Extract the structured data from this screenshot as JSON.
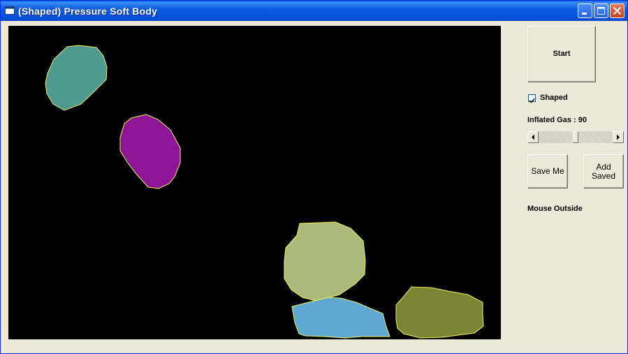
{
  "window": {
    "title": "(Shaped) Pressure Soft Body",
    "titlebar_color": "#0551DC",
    "icons": [
      "app-window-icon",
      "minimize-icon",
      "maximize-icon",
      "close-icon"
    ]
  },
  "controls": {
    "start_label": "Start",
    "shaped_label": "Shaped",
    "shaped_checked": true,
    "inflated_gas_label": "Inflated Gas : 90",
    "inflated_gas_value": 90,
    "inflated_gas_range": [
      0,
      180
    ],
    "save_label": "Save Me",
    "add_saved_label": "Add\nSaved",
    "mouse_status": "Mouse Outside"
  },
  "canvas": {
    "background": "#000000",
    "outline_color": "#F2F25A",
    "bodies": [
      {
        "name": "teal-body",
        "fill": "#4E9990"
      },
      {
        "name": "purple-body",
        "fill": "#8E1595"
      },
      {
        "name": "sage-body",
        "fill": "#ABBA7B"
      },
      {
        "name": "blue-body",
        "fill": "#5FA8D3"
      },
      {
        "name": "olive-body",
        "fill": "#7A8636"
      }
    ]
  }
}
